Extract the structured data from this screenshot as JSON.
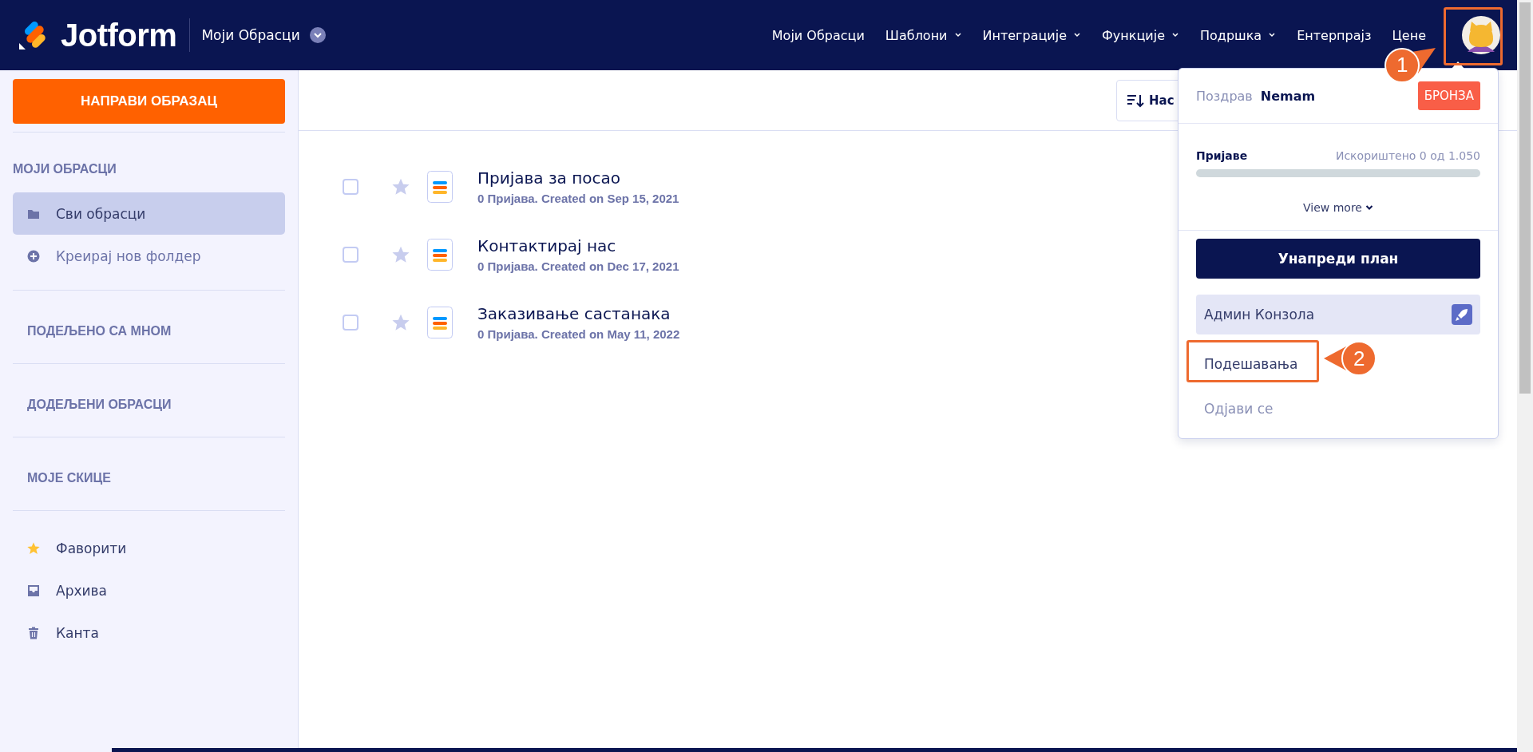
{
  "header": {
    "logo": "Jotform",
    "workspace": "Моји Обрасци",
    "nav": [
      {
        "label": "Моји Обрасци",
        "has_menu": false
      },
      {
        "label": "Шаблони",
        "has_menu": true
      },
      {
        "label": "Интеграције",
        "has_menu": true
      },
      {
        "label": "Функције",
        "has_menu": true
      },
      {
        "label": "Подршка",
        "has_menu": true
      },
      {
        "label": "Ентерпрајз",
        "has_menu": false
      },
      {
        "label": "Цене",
        "has_menu": false
      }
    ]
  },
  "sidebar": {
    "create_button": "НАПРАВИ ОБРАЗАЦ",
    "sections": [
      {
        "title": "МОЈИ ОБРАСЦИ",
        "items": [
          {
            "label": "Сви обрасци",
            "kind": "folder",
            "selected": true
          },
          {
            "label": "Креирај нов фолдер",
            "kind": "plus",
            "selected": false
          }
        ]
      },
      {
        "title": "ПОДЕЉЕНО СА МНОМ"
      },
      {
        "title": "ДОДЕЉЕНИ ОБРАСЦИ"
      },
      {
        "title": "МОЈЕ СКИЦЕ"
      },
      {
        "items": [
          {
            "label": "Фаворити",
            "kind": "star",
            "selected": false
          },
          {
            "label": "Архива",
            "kind": "archive",
            "selected": false
          },
          {
            "label": "Канта",
            "kind": "trash",
            "selected": false
          }
        ]
      }
    ]
  },
  "toolbar": {
    "sort_button": "Нас"
  },
  "forms": [
    {
      "title": "Пријава за посао",
      "meta": "0 Пријава. Created on Sep 15, 2021",
      "checked": false,
      "favorite": false
    },
    {
      "title": "Контактирај нас",
      "meta": "0 Пријава. Created on Dec 17, 2021",
      "checked": false,
      "favorite": false
    },
    {
      "title": "Заказивање састанака",
      "meta": "0 Пријава. Created on May 11, 2022",
      "checked": false,
      "favorite": false
    }
  ],
  "account_menu": {
    "greeting": "Поздрав",
    "user": "Nemam",
    "plan": "БРОНЗА",
    "usage": {
      "label": "Пријаве",
      "reading": "Искориштено 0 од 1.050",
      "level": 0
    },
    "view_more": "View more",
    "upgrade_button": "Унапреди план",
    "items": [
      {
        "label": "Админ Конзола",
        "kind": "admin"
      },
      {
        "label": "Подешавања",
        "kind": "plain"
      },
      {
        "label": "Одјави се",
        "kind": "muted"
      }
    ]
  },
  "annotations": [
    {
      "number": "1",
      "kind": "upright"
    },
    {
      "number": "2",
      "kind": "left"
    }
  ]
}
